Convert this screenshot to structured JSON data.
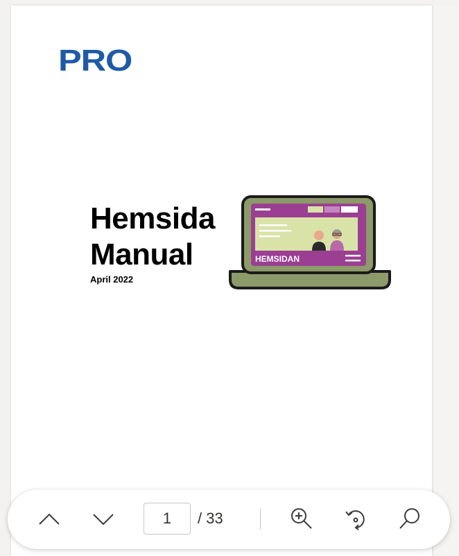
{
  "document": {
    "logo_text": "PRO",
    "title_line1": "Hemsida",
    "title_line2": "Manual",
    "date": "April 2022",
    "illustration_label": "HEMSIDAN"
  },
  "toolbar": {
    "current_page": "1",
    "total_pages": "/ 33",
    "icons": {
      "previous": "chevron-up-icon",
      "next": "chevron-down-icon",
      "zoom": "zoom-in-icon",
      "rotate": "rotate-icon",
      "search": "search-icon"
    }
  },
  "colors": {
    "logo_blue": "#1f5aa6",
    "laptop_green": "#8d9a6a",
    "screen_purple": "#9b3f93",
    "banner_light_green": "#d9e3a8"
  }
}
